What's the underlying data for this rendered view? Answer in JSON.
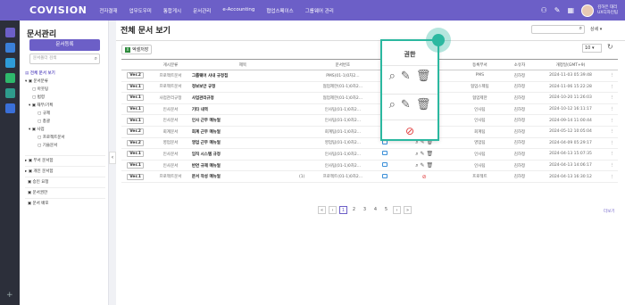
{
  "topbar": {
    "logo": "COVISION",
    "nav": [
      "전자결재",
      "업무도우미",
      "통합게시",
      "문서관리",
      "e-Accounting",
      "협업스페이스",
      "그룹웨어 관리"
    ],
    "user_name": "김하은 대리",
    "user_dept": "UX디자인팀"
  },
  "lnb": {
    "title": "문서관리",
    "register_button": "문서등록",
    "search_placeholder": "문서폴더 검색",
    "tree": [
      {
        "label": "전체 문서 보기",
        "selected": true
      },
      {
        "label": "문서분류"
      },
      {
        "label": "아웃팅"
      },
      {
        "label": "법령"
      },
      {
        "label": "재무/기획"
      },
      {
        "label": "규제"
      },
      {
        "label": "총괄"
      },
      {
        "label": "사업"
      },
      {
        "label": "프로젝트문서"
      },
      {
        "label": "기술문서"
      }
    ],
    "sections": [
      "부서 문서함",
      "개인 문서함",
      "승인 요청",
      "문서권한",
      "문서 배포"
    ]
  },
  "main": {
    "title": "전체 문서 보기",
    "detail_label": "상세",
    "excel_label": "엑셀저장",
    "page_size": "10",
    "columns": [
      "",
      "게시분류",
      "제목",
      "",
      "문서번호",
      "",
      "",
      "등록부서",
      "소유자",
      "개정일(GMT+9)"
    ],
    "rows": [
      {
        "ver": "Ver.2",
        "cat": "프로젝트문서",
        "title": "그룹웨어 사내 규정집",
        "att": "",
        "no": "PMS(01-1)0차2...",
        "dept": "PMS",
        "owner": "김하정",
        "date": "2024-11-03 05:39:48"
      },
      {
        "ver": "Ver.1",
        "cat": "프로젝트문서",
        "title": "정보보안 규정",
        "att": "",
        "no": "협업제한(01-1)0차2...",
        "dept": "협업스펙팀",
        "owner": "김하정",
        "date": "2024-11-06 15:22:28"
      },
      {
        "ver": "Ver.1",
        "cat": "사업관리규정",
        "title": "사업관리규정",
        "att": "",
        "no": "협업제한(01-1)0차2...",
        "dept": "협업제한",
        "owner": "김하정",
        "date": "2024-10-20 11:26:03"
      },
      {
        "ver": "Ver.1",
        "cat": "인사문서",
        "title": "기타 내역",
        "att": "",
        "no": "인사팀(01-1)0차2...",
        "dept": "인사팀",
        "owner": "김하정",
        "date": "2024-10-12 16:11:17"
      },
      {
        "ver": "Ver.1",
        "cat": "인사문서",
        "title": "인사 근무 매뉴얼",
        "att": "",
        "no": "인사팀(01-1)0차2...",
        "dept": "인사팀",
        "owner": "김하정",
        "date": "2024-09-14 11:00:44"
      },
      {
        "ver": "Ver.2",
        "cat": "회계문서",
        "title": "회계 근무 매뉴얼",
        "att": "",
        "no": "회계팀(01-1)0차2...",
        "dept": "회계팀",
        "owner": "김하정",
        "date": "2024-05-12 10:05:04"
      },
      {
        "ver": "Ver.2",
        "cat": "영업문서",
        "title": "영업 근무 매뉴얼",
        "att": "",
        "no": "영업팀(01-1)0차2...",
        "dept": "영업팀",
        "owner": "김하정",
        "date": "2024-04-09 05:29:17"
      },
      {
        "ver": "Ver.1",
        "cat": "인사문서",
        "title": "임직 시스템 규정",
        "att": "",
        "no": "인사팀(01-1)0차2...",
        "dept": "인사팀",
        "owner": "김하정",
        "date": "2024-04-13 15:07:35"
      },
      {
        "ver": "Ver.1",
        "cat": "인사문서",
        "title": "반연 규제 매뉴얼",
        "att": "",
        "no": "인사팀(01-1)0차2...",
        "dept": "인사팀",
        "owner": "김하정",
        "date": "2024-04-13 14:06:17"
      },
      {
        "ver": "Ver.1",
        "cat": "프로젝트문서",
        "title": "문서 작성 매뉴얼",
        "att": "(1)",
        "no": "프로젝트(01-1)0차2...",
        "dept": "프로젝트",
        "owner": "김하정",
        "date": "2024-04-13 16:30:12"
      }
    ],
    "pages": [
      "1",
      "2",
      "3",
      "4",
      "5"
    ],
    "more_label": "더보기"
  },
  "popup": {
    "title": "권한"
  }
}
